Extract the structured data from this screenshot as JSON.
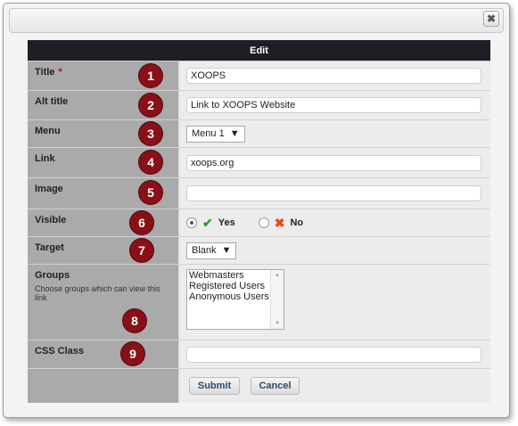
{
  "dialog": {
    "close_glyph": "✖"
  },
  "form": {
    "header": "Edit",
    "fields": {
      "title": {
        "label": "Title",
        "required_mark": "*",
        "value": "XOOPS",
        "badge": "1"
      },
      "alt_title": {
        "label": "Alt title",
        "value": "Link to XOOPS Website",
        "badge": "2"
      },
      "menu": {
        "label": "Menu",
        "value": "Menu 1",
        "badge": "3"
      },
      "link": {
        "label": "Link",
        "value": "xoops.org",
        "badge": "4"
      },
      "image": {
        "label": "Image",
        "value": "",
        "badge": "5"
      },
      "visible": {
        "label": "Visible",
        "yes_label": "Yes",
        "no_label": "No",
        "selected": "Yes",
        "badge": "6"
      },
      "target": {
        "label": "Target",
        "value": "Blank",
        "badge": "7"
      },
      "groups": {
        "label": "Groups",
        "help": "Choose groups which can view this link",
        "options": [
          "Webmasters",
          "Registered Users",
          "Anonymous Users"
        ],
        "badge": "8"
      },
      "css_class": {
        "label": "CSS Class",
        "value": "",
        "badge": "9"
      }
    },
    "buttons": {
      "submit": "Submit",
      "cancel": "Cancel"
    }
  },
  "colors": {
    "header_bg": "#1e1e26",
    "label_bg": "#aaaaaa",
    "badge": "#8b0f16",
    "check": "#2e9e2e",
    "cross": "#e84a1a"
  },
  "icons": {
    "yes": "check-icon",
    "no": "cross-icon",
    "close": "close-icon",
    "dropdown": "triangle-down-icon"
  }
}
